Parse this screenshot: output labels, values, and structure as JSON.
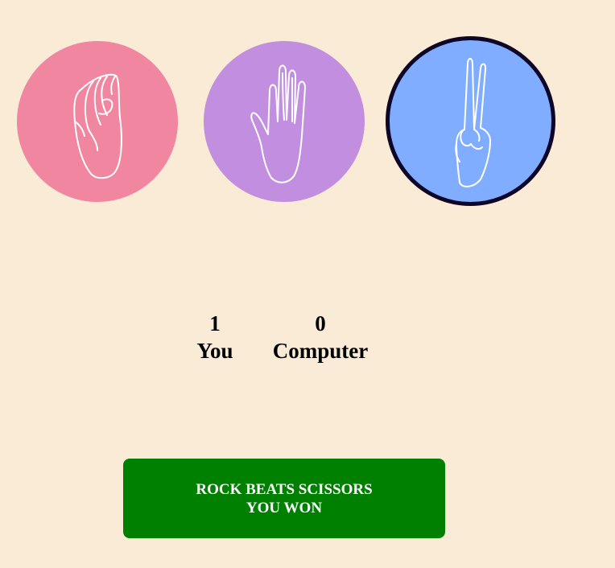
{
  "choices": [
    {
      "id": "rock",
      "icon": "fist-icon",
      "color": "#f0869f",
      "selected": false
    },
    {
      "id": "paper",
      "icon": "open-hand-icon",
      "color": "#c28ee0",
      "selected": false
    },
    {
      "id": "scissors",
      "icon": "peace-hand-icon",
      "color": "#80adff",
      "selected": true,
      "border_color": "#0d0626"
    }
  ],
  "scores": {
    "player": {
      "value": "1",
      "label": "You"
    },
    "computer": {
      "value": "0",
      "label": "Computer"
    }
  },
  "result": {
    "line1": "ROCK BEATS SCISSORS",
    "line2": "YOU WON",
    "color": "#008000"
  },
  "background_color": "#faebd7"
}
